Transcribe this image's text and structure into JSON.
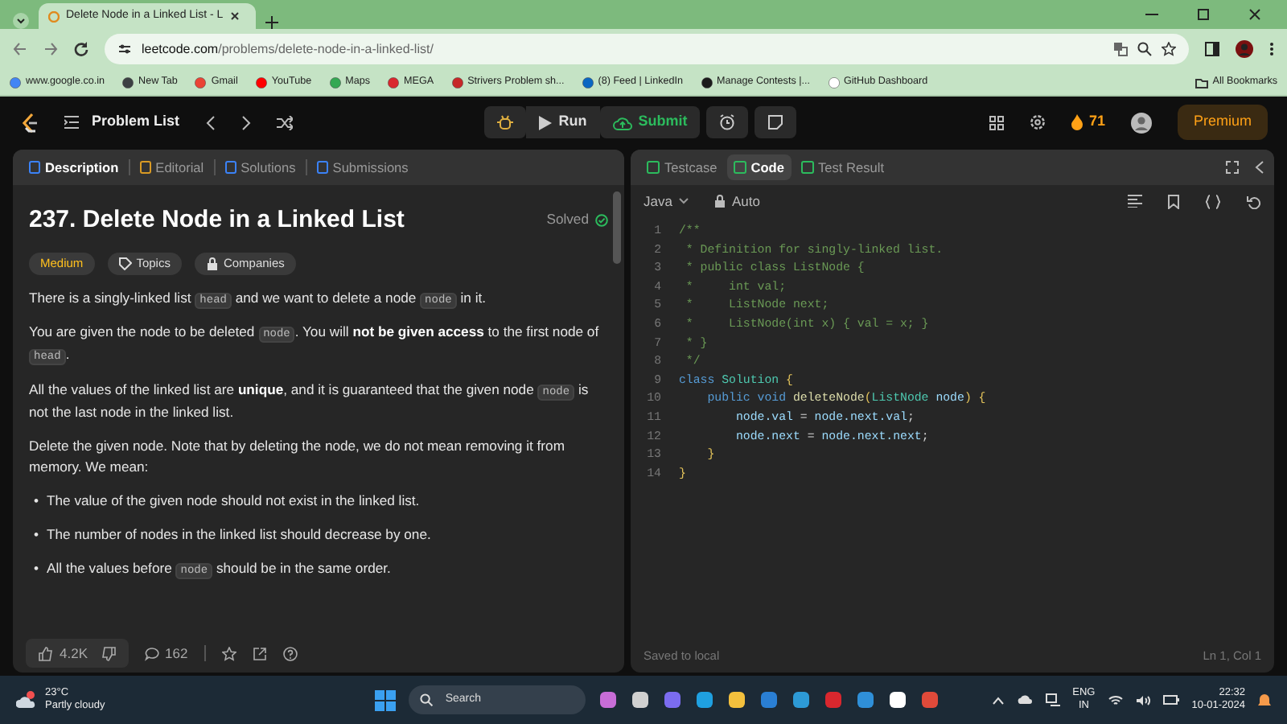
{
  "browser": {
    "tab_title": "Delete Node in a Linked List - L",
    "url_domain": "leetcode.com",
    "url_path": "/problems/delete-node-in-a-linked-list/",
    "bookmarks": [
      {
        "label": "www.google.co.in",
        "color": "#4285f4"
      },
      {
        "label": "New Tab",
        "color": "#3c4043"
      },
      {
        "label": "Gmail",
        "color": "#ea4335"
      },
      {
        "label": "YouTube",
        "color": "#ff0000"
      },
      {
        "label": "Maps",
        "color": "#34a853"
      },
      {
        "label": "MEGA",
        "color": "#d9272e"
      },
      {
        "label": "Strivers Problem sh...",
        "color": "#c62828"
      },
      {
        "label": "(8) Feed | LinkedIn",
        "color": "#0a66c2"
      },
      {
        "label": "Manage Contests |...",
        "color": "#1b1b1b"
      },
      {
        "label": "GitHub Dashboard",
        "color": "#ffffff"
      }
    ],
    "all_bookmarks": "All Bookmarks"
  },
  "header": {
    "problem_list": "Problem List",
    "run": "Run",
    "submit": "Submit",
    "streak": "71",
    "premium": "Premium"
  },
  "left_tabs": [
    {
      "label": "Description",
      "selected": true,
      "color": "#3b82f6"
    },
    {
      "label": "Editorial",
      "selected": false,
      "color": "#d99a24"
    },
    {
      "label": "Solutions",
      "selected": false,
      "color": "#3b82f6"
    },
    {
      "label": "Submissions",
      "selected": false,
      "color": "#3b82f6"
    }
  ],
  "problem": {
    "title": "237. Delete Node in a Linked List",
    "status": "Solved",
    "difficulty": "Medium",
    "tags": [
      "Topics",
      "Companies"
    ],
    "paragraphs": [
      [
        {
          "kind": "text",
          "text": "There is a singly-linked list "
        },
        {
          "kind": "code",
          "text": "head"
        },
        {
          "kind": "text",
          "text": " and we want to delete a node "
        },
        {
          "kind": "code",
          "text": "node"
        },
        {
          "kind": "text",
          "text": " in it."
        }
      ],
      [
        {
          "kind": "text",
          "text": "You are given the node to be deleted "
        },
        {
          "kind": "code",
          "text": "node"
        },
        {
          "kind": "text",
          "text": ". You will "
        },
        {
          "kind": "bold",
          "text": "not be given access"
        },
        {
          "kind": "text",
          "text": " to the first node of "
        },
        {
          "kind": "code",
          "text": "head"
        },
        {
          "kind": "text",
          "text": "."
        }
      ],
      [
        {
          "kind": "text",
          "text": "All the values of the linked list are "
        },
        {
          "kind": "bold",
          "text": "unique"
        },
        {
          "kind": "text",
          "text": ", and it is guaranteed that the given node "
        },
        {
          "kind": "code",
          "text": "node"
        },
        {
          "kind": "text",
          "text": " is not the last node in the linked list."
        }
      ],
      [
        {
          "kind": "text",
          "text": "Delete the given node. Note that by deleting the node, we do not mean removing it from memory. We mean:"
        }
      ]
    ],
    "bullets": [
      [
        {
          "kind": "marker",
          "text": "•"
        },
        {
          "kind": "text",
          "text": "The value of the given node should not exist in the linked list."
        }
      ],
      [
        {
          "kind": "marker",
          "text": "•"
        },
        {
          "kind": "text",
          "text": "The number of nodes in the linked list should decrease by one."
        }
      ],
      [
        {
          "kind": "marker",
          "text": "•"
        },
        {
          "kind": "text",
          "text": "All the values before "
        },
        {
          "kind": "code",
          "text": "node"
        },
        {
          "kind": "text",
          "text": " should be in the same order."
        }
      ]
    ]
  },
  "footer": {
    "likes": "4.2K",
    "comments": "162"
  },
  "right_tabs": [
    {
      "label": "Testcase",
      "selected": false,
      "color": "#2cbb5d"
    },
    {
      "label": "Code",
      "selected": true,
      "color": "#2cbb5d"
    },
    {
      "label": "Test Result",
      "selected": false,
      "color": "#2cbb5d"
    }
  ],
  "editor": {
    "language": "Java",
    "mode": "Auto",
    "lines": [
      {
        "number": "1",
        "tokens": [
          {
            "kind": "comment",
            "text": "/**"
          }
        ]
      },
      {
        "number": "2",
        "tokens": [
          {
            "kind": "comment",
            "text": " * Definition for singly-linked list."
          }
        ]
      },
      {
        "number": "3",
        "tokens": [
          {
            "kind": "comment",
            "text": " * public class ListNode {"
          }
        ]
      },
      {
        "number": "4",
        "tokens": [
          {
            "kind": "comment",
            "text": " *     int val;"
          }
        ]
      },
      {
        "number": "5",
        "tokens": [
          {
            "kind": "comment",
            "text": " *     ListNode next;"
          }
        ]
      },
      {
        "number": "6",
        "tokens": [
          {
            "kind": "comment",
            "text": " *     ListNode(int x) { val = x; }"
          }
        ]
      },
      {
        "number": "7",
        "tokens": [
          {
            "kind": "comment",
            "text": " * }"
          }
        ]
      },
      {
        "number": "8",
        "tokens": [
          {
            "kind": "comment",
            "text": " */"
          }
        ]
      },
      {
        "number": "9",
        "tokens": [
          {
            "kind": "keyword",
            "text": "class "
          },
          {
            "kind": "type",
            "text": "Solution "
          },
          {
            "kind": "bracket",
            "text": "{"
          }
        ]
      },
      {
        "number": "10",
        "tokens": [
          {
            "kind": "keyword",
            "text": "    public void "
          },
          {
            "kind": "function",
            "text": "deleteNode"
          },
          {
            "kind": "bracket",
            "text": "("
          },
          {
            "kind": "type",
            "text": "ListNode "
          },
          {
            "kind": "variable",
            "text": "node"
          },
          {
            "kind": "bracket",
            "text": ") {"
          }
        ]
      },
      {
        "number": "11",
        "tokens": [
          {
            "kind": "variable",
            "text": "        node.val"
          },
          {
            "kind": "plain",
            "text": " = "
          },
          {
            "kind": "variable",
            "text": "node.next.val"
          },
          {
            "kind": "plain",
            "text": ";"
          }
        ]
      },
      {
        "number": "12",
        "tokens": [
          {
            "kind": "variable",
            "text": "        node.next"
          },
          {
            "kind": "plain",
            "text": " = "
          },
          {
            "kind": "variable",
            "text": "node.next.next"
          },
          {
            "kind": "plain",
            "text": ";"
          }
        ]
      },
      {
        "number": "13",
        "tokens": [
          {
            "kind": "bracket",
            "text": "    }"
          }
        ]
      },
      {
        "number": "14",
        "tokens": [
          {
            "kind": "bracket",
            "text": "}"
          }
        ]
      }
    ],
    "status": "Saved to local",
    "cursor": "Ln 1, Col 1"
  },
  "taskbar": {
    "temperature": "23°C",
    "weather": "Partly cloudy",
    "search_placeholder": "Search",
    "language": "ENG",
    "region": "IN",
    "time": "22:32",
    "date": "10-01-2024"
  }
}
